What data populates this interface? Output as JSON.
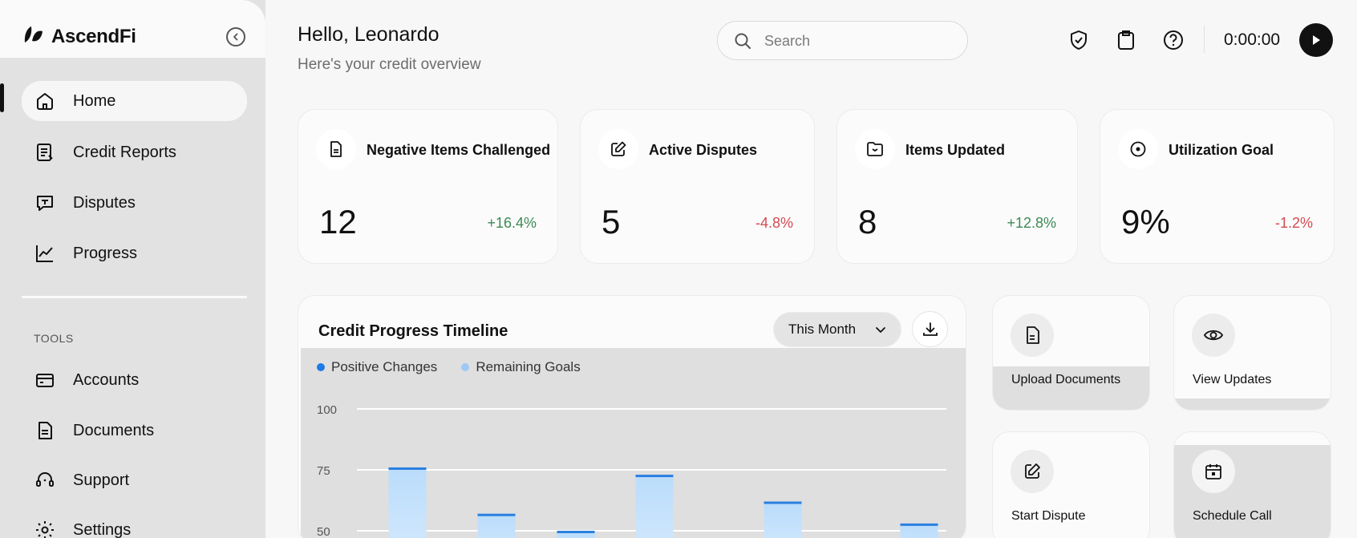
{
  "app": {
    "name": "AscendFi"
  },
  "sidebar": {
    "nav": [
      {
        "label": "Home",
        "icon": "home-icon",
        "active": true
      },
      {
        "label": "Credit Reports",
        "icon": "credit-report-icon"
      },
      {
        "label": "Disputes",
        "icon": "dispute-message-icon"
      },
      {
        "label": "Progress",
        "icon": "trend-chart-icon"
      }
    ],
    "tools_label": "TOOLS",
    "tools": [
      {
        "label": "Accounts",
        "icon": "card-icon"
      },
      {
        "label": "Documents",
        "icon": "document-icon"
      },
      {
        "label": "Support",
        "icon": "headset-icon"
      },
      {
        "label": "Settings",
        "icon": "gear-icon"
      }
    ]
  },
  "header": {
    "greeting": "Hello, Leonardo",
    "subtitle": "Here's your credit overview",
    "search_placeholder": "Search",
    "timer": "0:00:00"
  },
  "stats": [
    {
      "title": "Negative Items Challenged",
      "value": "12",
      "change": "+16.4%",
      "trend": "up",
      "icon": "document-icon"
    },
    {
      "title": "Active Disputes",
      "value": "5",
      "change": "-4.8%",
      "trend": "down",
      "icon": "edit-icon"
    },
    {
      "title": "Items Updated",
      "value": "8",
      "change": "+12.8%",
      "trend": "up",
      "icon": "folder-icon"
    },
    {
      "title": "Utilization Goal",
      "value": "9%",
      "change": "-1.2%",
      "trend": "down",
      "icon": "target-icon"
    }
  ],
  "timeline": {
    "title": "Credit Progress Timeline",
    "period": "This Month",
    "legend": [
      {
        "label": "Positive Changes",
        "color": "#1f7ae8"
      },
      {
        "label": "Remaining Goals",
        "color": "#9ec9f5"
      }
    ]
  },
  "chart_data": {
    "type": "bar",
    "yticks": [
      "100",
      "75",
      "50"
    ],
    "ylim": [
      0,
      100
    ],
    "series": [
      {
        "name": "Positive Changes",
        "values": [
          76,
          57,
          50,
          73,
          62,
          53
        ]
      }
    ],
    "colors": {
      "bar_top": "#b9dcfb",
      "bar_bottom": "#d6eafd",
      "bar_cap": "#2b7fe0"
    }
  },
  "quick_actions": [
    {
      "label": "Upload Documents",
      "icon": "upload-document-icon"
    },
    {
      "label": "View Updates",
      "icon": "eye-icon"
    },
    {
      "label": "Start Dispute",
      "icon": "edit-icon"
    },
    {
      "label": "Schedule Call",
      "icon": "calendar-icon"
    }
  ]
}
